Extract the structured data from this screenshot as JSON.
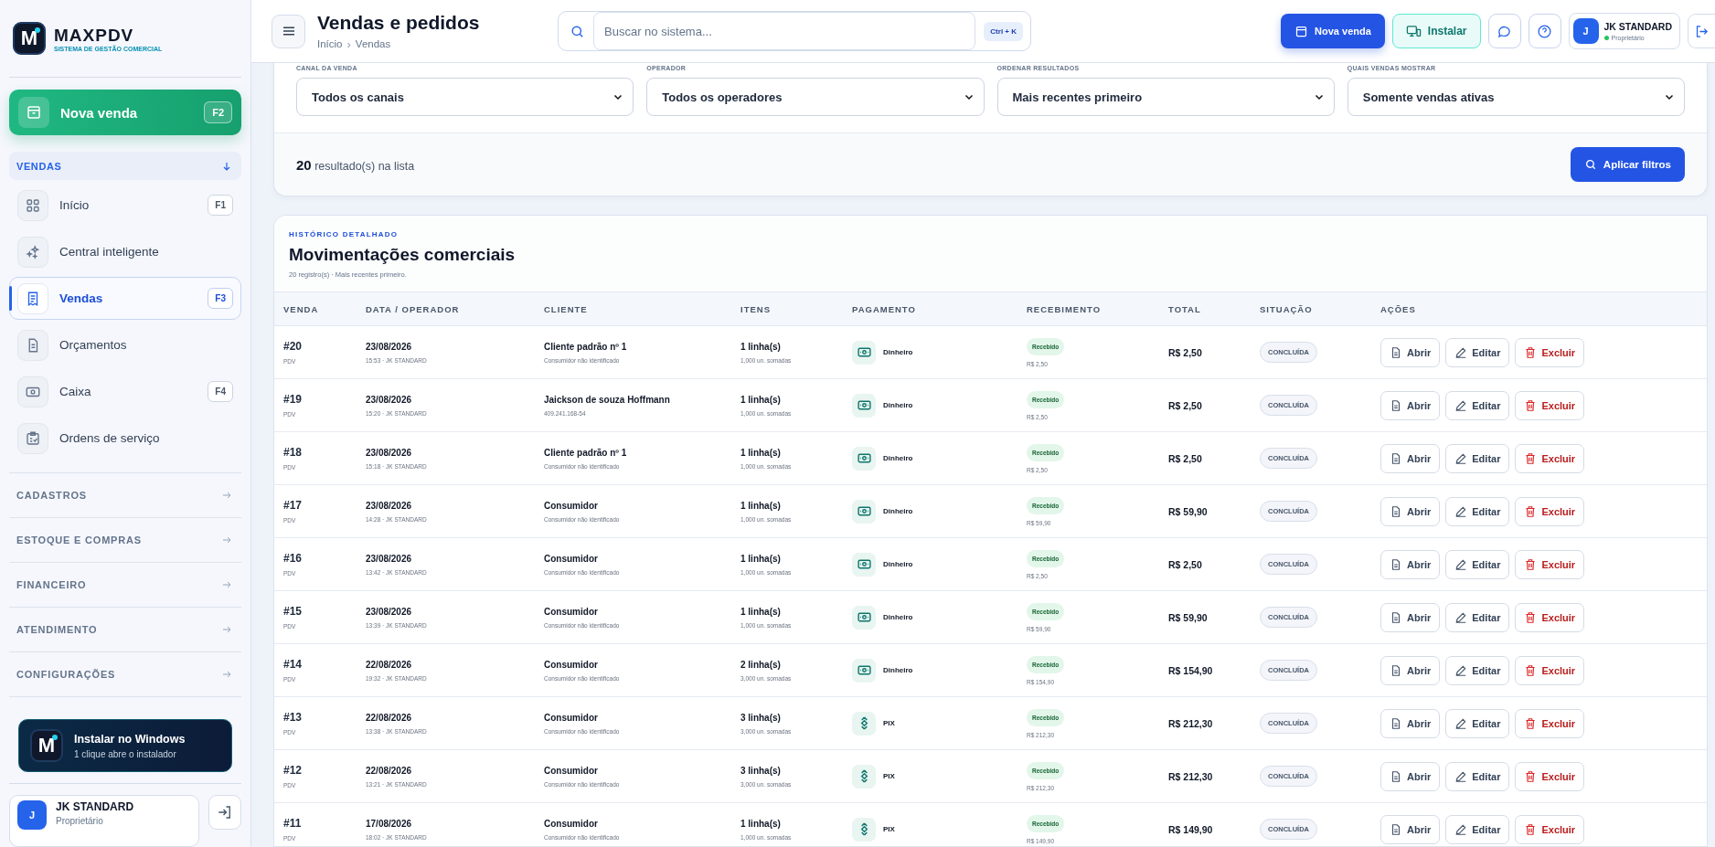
{
  "sidebar": {
    "logo": {
      "letter": "M",
      "name": "MAXPDV",
      "tagline": "SISTEMA DE GESTÃO COMERCIAL"
    },
    "new_sale": {
      "label": "Nova venda",
      "shortcut": "F2"
    },
    "section": {
      "title": "VENDAS",
      "expanded": true
    },
    "items": [
      {
        "kind": "grid",
        "label": "Início",
        "shortcut": "F1",
        "selected": false
      },
      {
        "kind": "sparkle",
        "label": "Central inteligente",
        "selected": false
      },
      {
        "kind": "receipt",
        "label": "Vendas",
        "shortcut": "F3",
        "selected": true
      },
      {
        "kind": "document",
        "label": "Orçamentos",
        "selected": false
      },
      {
        "kind": "cash",
        "label": "Caixa",
        "shortcut": "F4",
        "selected": false
      },
      {
        "kind": "clipboard",
        "label": "Ordens de serviço",
        "selected": false
      }
    ],
    "groups": [
      "CADASTROS",
      "ESTOQUE E COMPRAS",
      "FINANCEIRO",
      "ATENDIMENTO",
      "CONFIGURAÇÕES"
    ],
    "install": {
      "letter": "M",
      "title": "Instalar no Windows",
      "subtitle": "1 clique abre o instalador"
    },
    "user": {
      "initial": "J",
      "name": "JK STANDARD",
      "role": "Proprietário"
    }
  },
  "header": {
    "title": "Vendas e pedidos",
    "breadcrumb": [
      "Início",
      "Vendas"
    ],
    "breadcrumb_separator": "›",
    "search": {
      "placeholder": "Buscar no sistema...",
      "shortcut": "Ctrl + K"
    },
    "new_sale_button": "Nova venda",
    "install_button": "Instalar",
    "user": {
      "initial": "J",
      "name": "JK STANDARD",
      "role": "Proprietário",
      "online": true
    }
  },
  "filters": [
    {
      "label": "CANAL DA VENDA",
      "value": "Todos os canais"
    },
    {
      "label": "OPERADOR",
      "value": "Todos os operadores"
    },
    {
      "label": "ORDENAR RESULTADOS",
      "value": "Mais recentes primeiro"
    },
    {
      "label": "QUAIS VENDAS MOSTRAR",
      "value": "Somente vendas ativas"
    }
  ],
  "results": {
    "count": "20",
    "text": "resultado(s) na lista"
  },
  "apply_button": "Aplicar filtros",
  "history": {
    "eyebrow": "HISTÓRICO DETALHADO",
    "title": "Movimentações comerciais",
    "subtitle": "20 registro(s) · Mais recentes primeiro.",
    "columns": [
      "VENDA",
      "DATA / OPERADOR",
      "CLIENTE",
      "ITENS",
      "PAGAMENTO",
      "RECEBIMENTO",
      "TOTAL",
      "SITUAÇÃO",
      "AÇÕES"
    ],
    "rows": [
      {
        "id": "#20",
        "origin": "PDV",
        "date": "23/08/2026",
        "time_operator": "15:53 · JK STANDARD",
        "client": "Cliente padrão nº 1",
        "client_detail": "Consumidor não identificado",
        "items": "1 linha(s)",
        "items_detail": "1,000 un. somadas",
        "payment": {
          "kind": "cash",
          "label": "Dinheiro"
        },
        "receipt": "Recebido",
        "receipt_amount": "R$ 2,50",
        "total": "R$ 2,50",
        "status": "CONCLUÍDA",
        "actions": [
          {
            "kind": "open",
            "label": "Abrir"
          },
          {
            "kind": "edit",
            "label": "Editar"
          },
          {
            "kind": "delete",
            "label": "Excluir"
          }
        ]
      },
      {
        "id": "#19",
        "origin": "PDV",
        "date": "23/08/2026",
        "time_operator": "15:20 · JK STANDARD",
        "client": "Jaickson de souza Hoffmann",
        "client_detail": "409.241.168-54",
        "items": "1 linha(s)",
        "items_detail": "1,000 un. somadas",
        "payment": {
          "kind": "cash",
          "label": "Dinheiro"
        },
        "receipt": "Recebido",
        "receipt_amount": "R$ 2,50",
        "total": "R$ 2,50",
        "status": "CONCLUÍDA",
        "actions": [
          {
            "kind": "open",
            "label": "Abrir"
          },
          {
            "kind": "edit",
            "label": "Editar"
          },
          {
            "kind": "delete",
            "label": "Excluir"
          }
        ]
      },
      {
        "id": "#18",
        "origin": "PDV",
        "date": "23/08/2026",
        "time_operator": "15:18 · JK STANDARD",
        "client": "Cliente padrão nº 1",
        "client_detail": "Consumidor não identificado",
        "items": "1 linha(s)",
        "items_detail": "1,000 un. somadas",
        "payment": {
          "kind": "cash",
          "label": "Dinheiro"
        },
        "receipt": "Recebido",
        "receipt_amount": "R$ 2,50",
        "total": "R$ 2,50",
        "status": "CONCLUÍDA",
        "actions": [
          {
            "kind": "open",
            "label": "Abrir"
          },
          {
            "kind": "edit",
            "label": "Editar"
          },
          {
            "kind": "delete",
            "label": "Excluir"
          }
        ]
      },
      {
        "id": "#17",
        "origin": "PDV",
        "date": "23/08/2026",
        "time_operator": "14:28 · JK STANDARD",
        "client": "Consumidor",
        "client_detail": "Consumidor não identificado",
        "items": "1 linha(s)",
        "items_detail": "1,000 un. somadas",
        "payment": {
          "kind": "cash",
          "label": "Dinheiro"
        },
        "receipt": "Recebido",
        "receipt_amount": "R$ 59,90",
        "total": "R$ 59,90",
        "status": "CONCLUÍDA",
        "actions": [
          {
            "kind": "open",
            "label": "Abrir"
          },
          {
            "kind": "edit",
            "label": "Editar"
          },
          {
            "kind": "delete",
            "label": "Excluir"
          }
        ]
      },
      {
        "id": "#16",
        "origin": "PDV",
        "date": "23/08/2026",
        "time_operator": "13:42 · JK STANDARD",
        "client": "Consumidor",
        "client_detail": "Consumidor não identificado",
        "items": "1 linha(s)",
        "items_detail": "1,000 un. somadas",
        "payment": {
          "kind": "cash",
          "label": "Dinheiro"
        },
        "receipt": "Recebido",
        "receipt_amount": "R$ 2,50",
        "total": "R$ 2,50",
        "status": "CONCLUÍDA",
        "actions": [
          {
            "kind": "open",
            "label": "Abrir"
          },
          {
            "kind": "edit",
            "label": "Editar"
          },
          {
            "kind": "delete",
            "label": "Excluir"
          }
        ]
      },
      {
        "id": "#15",
        "origin": "PDV",
        "date": "23/08/2026",
        "time_operator": "13:39 · JK STANDARD",
        "client": "Consumidor",
        "client_detail": "Consumidor não identificado",
        "items": "1 linha(s)",
        "items_detail": "1,000 un. somadas",
        "payment": {
          "kind": "cash",
          "label": "Dinheiro"
        },
        "receipt": "Recebido",
        "receipt_amount": "R$ 59,90",
        "total": "R$ 59,90",
        "status": "CONCLUÍDA",
        "actions": [
          {
            "kind": "open",
            "label": "Abrir"
          },
          {
            "kind": "edit",
            "label": "Editar"
          },
          {
            "kind": "delete",
            "label": "Excluir"
          }
        ]
      },
      {
        "id": "#14",
        "origin": "PDV",
        "date": "22/08/2026",
        "time_operator": "19:32 · JK STANDARD",
        "client": "Consumidor",
        "client_detail": "Consumidor não identificado",
        "items": "2 linha(s)",
        "items_detail": "3,000 un. somadas",
        "payment": {
          "kind": "cash",
          "label": "Dinheiro"
        },
        "receipt": "Recebido",
        "receipt_amount": "R$ 154,90",
        "total": "R$ 154,90",
        "status": "CONCLUÍDA",
        "actions": [
          {
            "kind": "open",
            "label": "Abrir"
          },
          {
            "kind": "edit",
            "label": "Editar"
          },
          {
            "kind": "delete",
            "label": "Excluir"
          }
        ]
      },
      {
        "id": "#13",
        "origin": "PDV",
        "date": "22/08/2026",
        "time_operator": "13:38 · JK STANDARD",
        "client": "Consumidor",
        "client_detail": "Consumidor não identificado",
        "items": "3 linha(s)",
        "items_detail": "3,000 un. somadas",
        "payment": {
          "kind": "pix",
          "label": "PIX"
        },
        "receipt": "Recebido",
        "receipt_amount": "R$ 212,30",
        "total": "R$ 212,30",
        "status": "CONCLUÍDA",
        "actions": [
          {
            "kind": "open",
            "label": "Abrir"
          },
          {
            "kind": "edit",
            "label": "Editar"
          },
          {
            "kind": "delete",
            "label": "Excluir"
          }
        ]
      },
      {
        "id": "#12",
        "origin": "PDV",
        "date": "22/08/2026",
        "time_operator": "13:21 · JK STANDARD",
        "client": "Consumidor",
        "client_detail": "Consumidor não identificado",
        "items": "3 linha(s)",
        "items_detail": "3,000 un. somadas",
        "payment": {
          "kind": "pix",
          "label": "PIX"
        },
        "receipt": "Recebido",
        "receipt_amount": "R$ 212,30",
        "total": "R$ 212,30",
        "status": "CONCLUÍDA",
        "actions": [
          {
            "kind": "open",
            "label": "Abrir"
          },
          {
            "kind": "edit",
            "label": "Editar"
          },
          {
            "kind": "delete",
            "label": "Excluir"
          }
        ]
      },
      {
        "id": "#11",
        "origin": "PDV",
        "date": "17/08/2026",
        "time_operator": "18:02 · JK STANDARD",
        "client": "Consumidor",
        "client_detail": "Consumidor não identificado",
        "items": "1 linha(s)",
        "items_detail": "1,000 un. somadas",
        "payment": {
          "kind": "pix",
          "label": "PIX"
        },
        "receipt": "Recebido",
        "receipt_amount": "R$ 149,90",
        "total": "R$ 149,90",
        "status": "CONCLUÍDA",
        "actions": [
          {
            "kind": "open",
            "label": "Abrir"
          },
          {
            "kind": "edit",
            "label": "Editar"
          },
          {
            "kind": "delete",
            "label": "Excluir"
          }
        ]
      }
    ]
  }
}
